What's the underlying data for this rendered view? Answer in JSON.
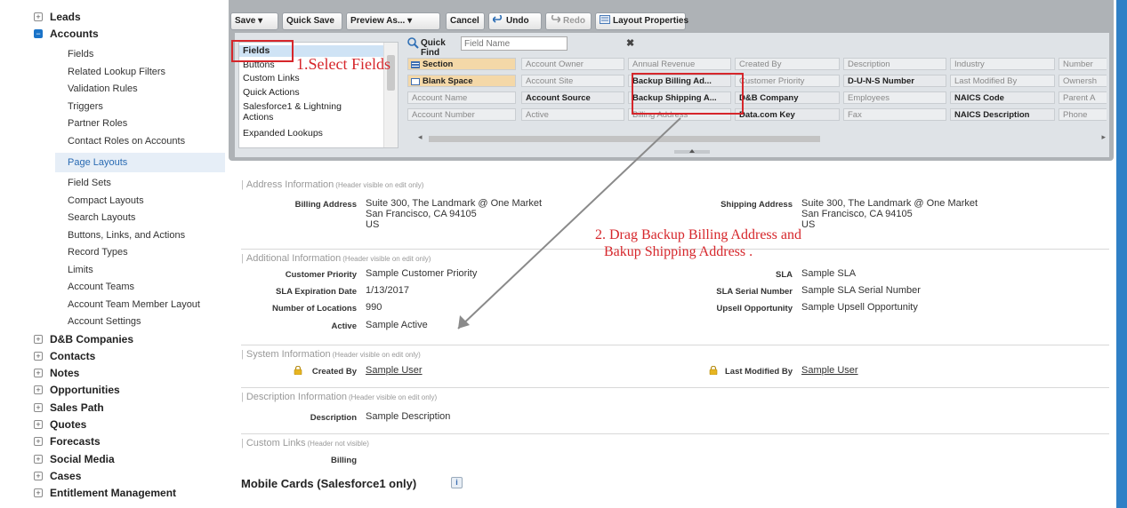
{
  "sidebar": {
    "top_items": [
      {
        "label": "Leads",
        "toggle": "+",
        "open": false
      },
      {
        "label": "Accounts",
        "toggle": "−",
        "open": true
      }
    ],
    "account_items": [
      "Fields",
      "Related Lookup Filters",
      "Validation Rules",
      "Triggers",
      "Partner Roles",
      "Contact Roles on Accounts",
      "Page Layouts",
      "Field Sets",
      "Compact Layouts",
      "Search Layouts",
      "Buttons, Links, and Actions",
      "Record Types",
      "Limits",
      "Account Teams",
      "Account Team Member Layout",
      "Account Settings"
    ],
    "active_item": "Page Layouts",
    "bottom_items": [
      "D&B Companies",
      "Contacts",
      "Notes",
      "Opportunities",
      "Sales Path",
      "Quotes",
      "Forecasts",
      "Social Media",
      "Cases",
      "Entitlement Management"
    ],
    "toggle_symbol": "+"
  },
  "toolbar": {
    "save": "Save ▾",
    "quick_save": "Quick Save",
    "preview": "Preview As... ▾",
    "cancel": "Cancel",
    "undo": "Undo",
    "redo": "Redo",
    "layout_properties": "Layout Properties"
  },
  "palette": {
    "categories": [
      "Fields",
      "Buttons",
      "Custom Links",
      "Quick Actions",
      "Salesforce1 & Lightning",
      "Actions",
      "Expanded Lookups"
    ],
    "quick_find_label": "Quick Find",
    "quick_find_placeholder": "Field Name",
    "clear_symbol": "✖",
    "fields": [
      [
        "Section",
        "Account Owner",
        "Annual Revenue",
        "Created By",
        "Description",
        "Industry",
        "Number"
      ],
      [
        "Blank Space",
        "Account Site",
        "Backup Billing Ad...",
        "Customer Priority",
        "D-U-N-S Number",
        "Last Modified By",
        "Ownersh"
      ],
      [
        "Account Name",
        "Account Source",
        "Backup Shipping A...",
        "D&B Company",
        "Employees",
        "NAICS Code",
        "Parent A"
      ],
      [
        "Account Number",
        "Active",
        "Billing Address",
        "Data.com Key",
        "Fax",
        "NAICS Description",
        "Phone"
      ]
    ],
    "scroll_left": "◂",
    "scroll_right": "▸"
  },
  "annotations": {
    "step1": "1.Select Fields",
    "step2_line1": "2. Drag Backup Billing Address and",
    "step2_line2": "Bakup Shipping Address ."
  },
  "layout": {
    "address_section": {
      "title": "Address Information",
      "note": "(Header visible on edit only)",
      "billing_label": "Billing Address",
      "billing_value": [
        "Suite 300, The Landmark @ One Market",
        "San Francisco, CA 94105",
        "US"
      ],
      "shipping_label": "Shipping Address",
      "shipping_value": [
        "Suite 300, The Landmark @ One Market",
        "San Francisco, CA 94105",
        "US"
      ]
    },
    "additional_section": {
      "title": "Additional Information",
      "note": "(Header visible on edit only)",
      "left_rows": [
        {
          "label": "Customer Priority",
          "value": "Sample Customer Priority"
        },
        {
          "label": "SLA Expiration Date",
          "value": "1/13/2017"
        },
        {
          "label": "Number of Locations",
          "value": "990"
        },
        {
          "label": "Active",
          "value": "Sample Active"
        }
      ],
      "right_rows": [
        {
          "label": "SLA",
          "value": "Sample SLA"
        },
        {
          "label": "SLA Serial Number",
          "value": "Sample SLA Serial Number"
        },
        {
          "label": "Upsell Opportunity",
          "value": "Sample Upsell Opportunity"
        }
      ]
    },
    "system_section": {
      "title": "System Information",
      "note": "(Header visible on edit only)",
      "created_by_label": "Created By",
      "created_by_value": "Sample User",
      "modified_by_label": "Last Modified By",
      "modified_by_value": "Sample User"
    },
    "description_section": {
      "title": "Description Information",
      "note": "(Header visible on edit only)",
      "label": "Description",
      "value": "Sample Description"
    },
    "custom_links_section": {
      "title": "Custom Links",
      "note": "(Header not visible)",
      "label": "Billing"
    },
    "mobile_cards_title": "Mobile Cards (Salesforce1 only)",
    "info_symbol": "i"
  },
  "colors": {
    "annotation_red": "#d6262b",
    "accent_blue": "#2f80c6",
    "section_field_orange": "#f4d8a8"
  }
}
